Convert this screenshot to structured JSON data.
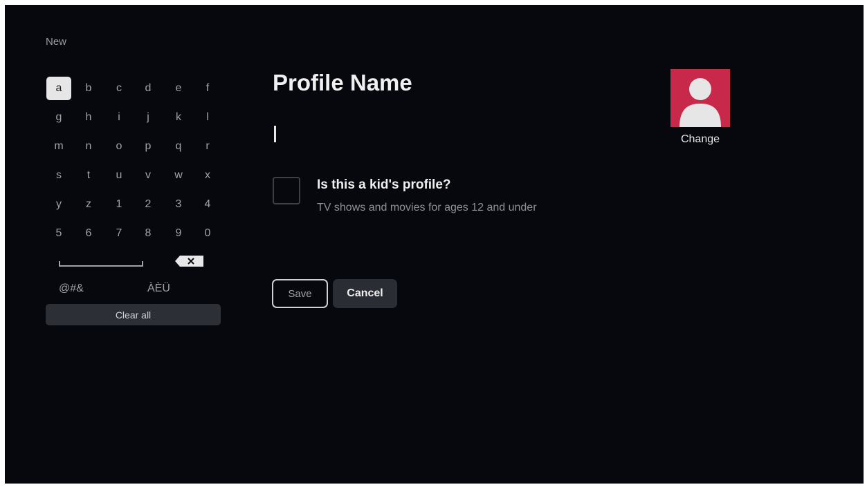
{
  "header": {
    "label": "New"
  },
  "keyboard": {
    "rows": [
      [
        "a",
        "b",
        "c",
        "d",
        "e",
        "f"
      ],
      [
        "g",
        "h",
        "i",
        "j",
        "k",
        "l"
      ],
      [
        "m",
        "n",
        "o",
        "p",
        "q",
        "r"
      ],
      [
        "s",
        "t",
        "u",
        "v",
        "w",
        "x"
      ],
      [
        "y",
        "z",
        "1",
        "2",
        "3",
        "4"
      ],
      [
        "5",
        "6",
        "7",
        "8",
        "9",
        "0"
      ]
    ],
    "selected_key": "a",
    "symbols_label": "@#&",
    "accents_label": "ÀÈÜ",
    "clear_label": "Clear all",
    "space_icon": "space-bar-icon",
    "backspace_icon": "backspace-icon"
  },
  "form": {
    "title": "Profile Name",
    "name_value": "",
    "kid_question": "Is this a kid's profile?",
    "kid_description": "TV shows and movies for ages 12 and under",
    "kid_checked": false,
    "save_label": "Save",
    "cancel_label": "Cancel"
  },
  "avatar": {
    "change_label": "Change",
    "icon": "person-avatar-icon",
    "color": "#c8284a"
  }
}
